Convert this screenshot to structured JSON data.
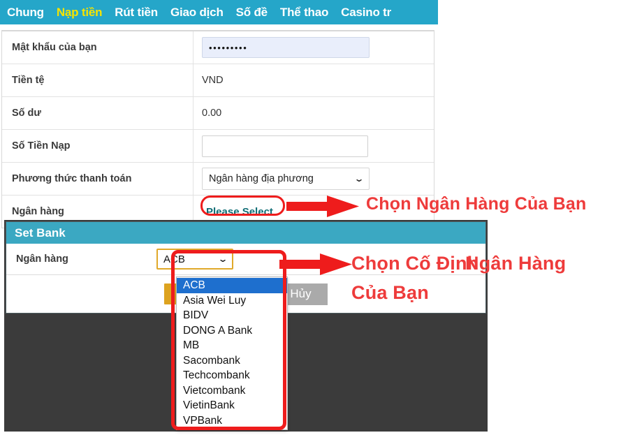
{
  "nav": {
    "items": [
      {
        "label": "Chung",
        "active": false
      },
      {
        "label": "Nạp tiền",
        "active": true
      },
      {
        "label": "Rút tiền",
        "active": false
      },
      {
        "label": "Giao dịch",
        "active": false
      },
      {
        "label": "Số đề",
        "active": false
      },
      {
        "label": "Thể thao",
        "active": false
      },
      {
        "label": "Casino tr",
        "active": false
      }
    ]
  },
  "form": {
    "rows": [
      {
        "label": "Mật khẩu của bạn",
        "type": "password",
        "value": "•••••••••"
      },
      {
        "label": "Tiền tệ",
        "type": "text",
        "value": "VND"
      },
      {
        "label": "Số dư",
        "type": "text",
        "value": "0.00"
      },
      {
        "label": "Số Tiền Nạp",
        "type": "input",
        "value": "",
        "placeholder": ""
      },
      {
        "label": "Phương thức thanh toán",
        "type": "select",
        "value": "Ngân hàng địa phương"
      },
      {
        "label": "Ngân hàng",
        "type": "link",
        "value": "Please Select"
      }
    ]
  },
  "dialog": {
    "title": "Set Bank",
    "row_label": "Ngân hàng",
    "selected_bank": "ACB",
    "confirm_label": "",
    "cancel_label": "Hủy",
    "options": [
      "ACB",
      "Asia Wei Luy",
      "BIDV",
      "DONG A Bank",
      "MB",
      "Sacombank",
      "Techcombank",
      "Vietcombank",
      "VietinBank",
      "VPBank"
    ]
  },
  "annotations": {
    "line1": "Chọn Ngân Hàng Của Bạn",
    "line2a": "Chọn Cố Định",
    "line2b": "Ngân Hàng",
    "line2c": "Của Bạn"
  },
  "colors": {
    "nav_bg": "#25a6c9",
    "nav_active": "#f6e400",
    "dialog_header": "#3ba8c2",
    "annotation_red": "#ee3b3b",
    "highlight_red": "#ee1c1c",
    "option_selected": "#1e6fce",
    "confirm_button": "#dda31f",
    "cancel_button": "#aaaaaa",
    "backdrop": "#3b3b3b"
  },
  "icons": {
    "chevron_down": "⌄"
  }
}
